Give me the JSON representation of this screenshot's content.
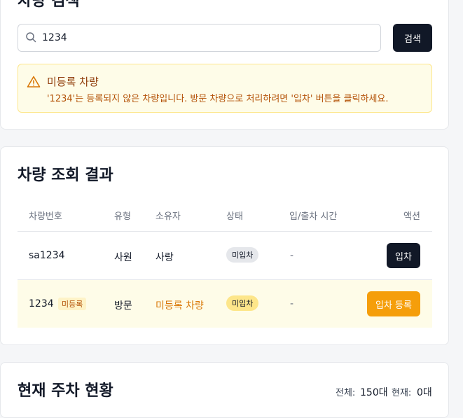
{
  "search_section": {
    "title": "차량 검색",
    "input_value": "1234",
    "search_button": "검색"
  },
  "alert": {
    "title": "미등록 차량",
    "message": "'1234'는 등록되지 않은 차량입니다. 방문 차량으로 처리하려면 '입차' 버튼을 클릭하세요."
  },
  "results": {
    "title": "차량 조회 결과",
    "columns": [
      "차량번호",
      "유형",
      "소유자",
      "상태",
      "입/출차 시간",
      "액션"
    ],
    "rows": [
      {
        "plate": "sa1234",
        "type": "사원",
        "owner": "사랑",
        "status": "미입차",
        "time": "-",
        "action": "입차"
      },
      {
        "plate": "1234",
        "tag": "미등록",
        "type": "방문",
        "owner": "미등록 차량",
        "status": "미입차",
        "time": "-",
        "action": "입차 등록"
      }
    ]
  },
  "parking_status": {
    "title": "현재 주차 현황",
    "total_label": "전체:",
    "total_value": "150대",
    "current_label": "현재:",
    "current_value": "0대"
  },
  "colors": {
    "primary": "#111827",
    "accent": "#f59e0b",
    "warning_bg": "#fefce8",
    "warning_text": "#b45309"
  }
}
